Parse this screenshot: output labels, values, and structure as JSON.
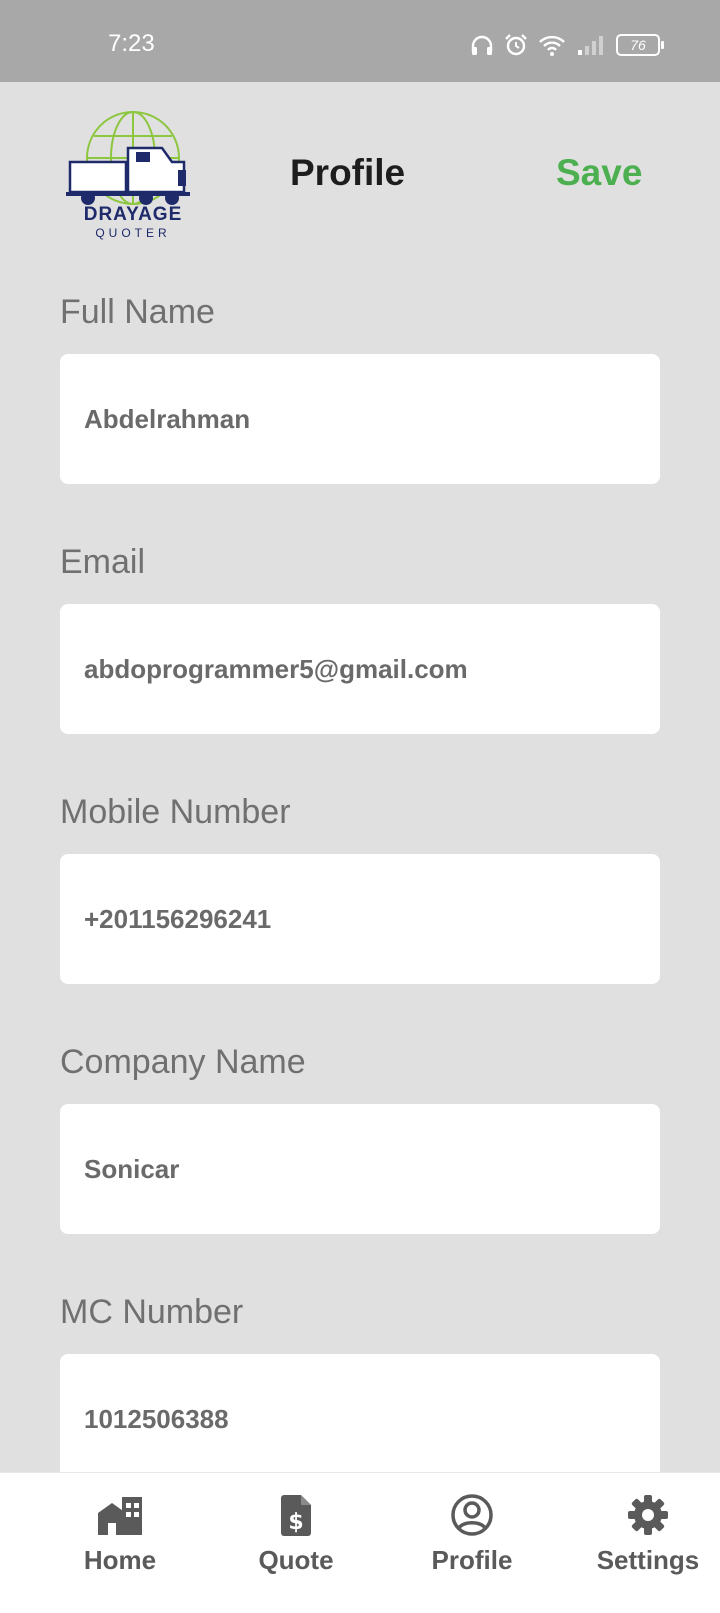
{
  "status_bar": {
    "time": "7:23",
    "battery": "76"
  },
  "header": {
    "logo_text": "DRAYAGE",
    "logo_subtext": "QUOTER",
    "title": "Profile",
    "save_label": "Save"
  },
  "fields": {
    "full_name": {
      "label": "Full Name",
      "value": "Abdelrahman"
    },
    "email": {
      "label": "Email",
      "value": "abdoprogrammer5@gmail.com"
    },
    "mobile": {
      "label": "Mobile Number",
      "value": "+201156296241"
    },
    "company": {
      "label": "Company Name",
      "value": "Sonicar"
    },
    "mc_number": {
      "label": "MC Number",
      "value": "1012506388"
    }
  },
  "nav": {
    "home": "Home",
    "quote": "Quote",
    "profile": "Profile",
    "settings": "Settings"
  },
  "colors": {
    "accent_green": "#4caf50",
    "logo_navy": "#1f2a6b",
    "logo_globe": "#8dc63f",
    "background": "#e0e0e0"
  }
}
